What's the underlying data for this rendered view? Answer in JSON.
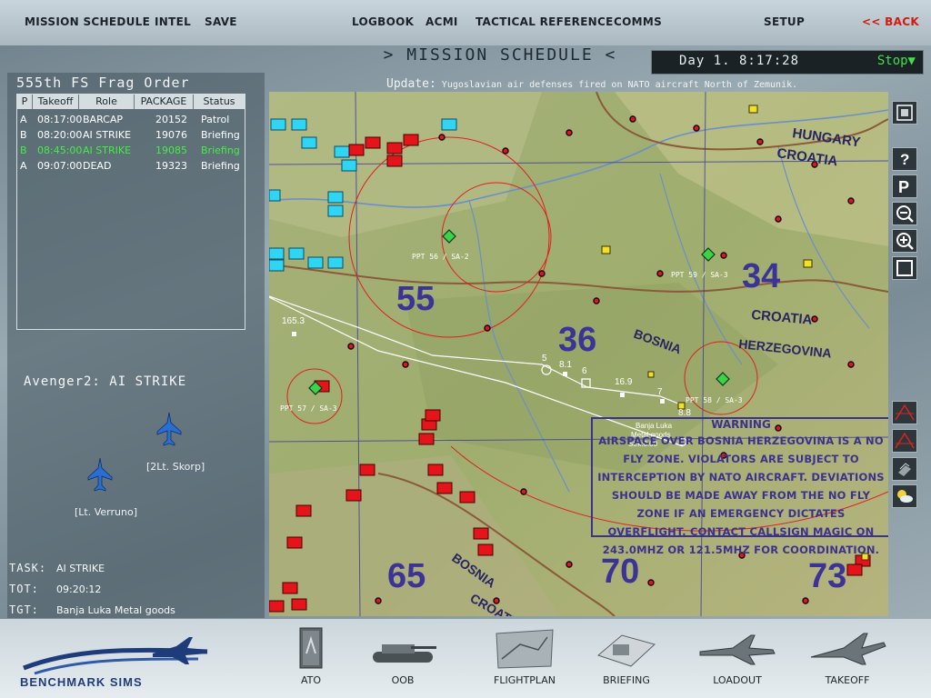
{
  "top_menu": {
    "mission_schedule": "MISSION SCHEDULE",
    "intel": "INTEL",
    "save": "SAVE",
    "logbook": "LOGBOOK",
    "acmi": "ACMI",
    "tactical_reference": "TACTICAL REFERENCE",
    "comms": "COMMS",
    "setup": "SETUP",
    "back": "<< BACK"
  },
  "screen_title": ">  MISSION SCHEDULE  <",
  "clock": {
    "day": "Day  1. 8:17:28",
    "stop": "Stop▼"
  },
  "update": {
    "label": "Update:",
    "message": "Yugoslavian air defenses fired on NATO aircraft North of Zemunik."
  },
  "frag_order": {
    "title": "555th FS Frag Order",
    "columns": [
      "P",
      "Takeoff",
      "Role",
      "PACKAGE",
      "Status"
    ],
    "rows": [
      {
        "p": "A",
        "takeoff": "08:17:00",
        "role": "BARCAP",
        "package": "20152",
        "status": "Patrol",
        "selected": false
      },
      {
        "p": "B",
        "takeoff": "08:20:00",
        "role": "AI STRIKE",
        "package": "19076",
        "status": "Briefing",
        "selected": false
      },
      {
        "p": "B",
        "takeoff": "08:45:00",
        "role": "AI STRIKE",
        "package": "19085",
        "status": "Briefing",
        "selected": true
      },
      {
        "p": "A",
        "takeoff": "09:07:00",
        "role": "DEAD",
        "package": "19323",
        "status": "Briefing",
        "selected": false
      }
    ]
  },
  "flight": {
    "name": "Avenger2: AI STRIKE",
    "pilots": [
      "[2Lt. Skorp]",
      "[Lt. Verruno]"
    ]
  },
  "task": {
    "task_label": "TASK:",
    "task_value": "AI STRIKE",
    "tot_label": "TOT:",
    "tot_value": "09:20:12",
    "tgt_label": "TGT:",
    "tgt_value": "Banja Luka Metal goods"
  },
  "map": {
    "countries": [
      "HUNGARY",
      "CROATIA",
      "CROATIA",
      "BOSNIA",
      "HERZEGOVINA",
      "BOSNIA",
      "CROATIA"
    ],
    "sector_numbers": [
      "55",
      "36",
      "34",
      "65",
      "70",
      "73"
    ],
    "threat_labels": [
      "PPT 56 / SA-2",
      "PPT 59 / SA-3",
      "PPT 58 / SA-3",
      "PPT 57 / SA-3"
    ],
    "waypoints": [
      "165.3",
      "5",
      "8.1",
      "6",
      "16.9",
      "7",
      "8.8"
    ],
    "target_labels": [
      "Banja Luka",
      "Metal goods",
      "Strk:0.00"
    ],
    "warning": {
      "title": "WARNING",
      "text": "AIRSPACE OVER BOSNIA HERZEGOVINA IS A NO FLY ZONE. VIOLATORS ARE SUBJECT TO INTERCEPTION BY NATO AIRCRAFT. DEVIATIONS SHOULD BE MADE AWAY FROM THE NO FLY ZONE IF AN EMERGENCY DICTATES OVERFLIGHT. CONTACT CALLSIGN MAGIC ON 243.0MHZ OR 121.5MHZ FOR COORDINATION."
    },
    "tools": [
      "zoom-fit-icon",
      "help-icon",
      "parking-icon",
      "zoom-out-icon",
      "zoom-in-icon",
      "fullscreen-icon",
      "threat-range-icon",
      "threat-range2-icon",
      "layers-icon",
      "weather-icon"
    ]
  },
  "bottom_nav": [
    {
      "label": "ATO",
      "icon": "binder-icon"
    },
    {
      "label": "OOB",
      "icon": "tank-icon"
    },
    {
      "label": "FLIGHTPLAN",
      "icon": "map-icon"
    },
    {
      "label": "BRIEFING",
      "icon": "briefing-icon"
    },
    {
      "label": "LOADOUT",
      "icon": "loadout-jet-icon"
    },
    {
      "label": "TAKEOFF",
      "icon": "takeoff-jet-icon"
    }
  ],
  "logo_text": "BENCHMARK SIMS",
  "colors": {
    "accent_red": "#d11a12",
    "selected_green": "#40f040",
    "warning_blue": "#3d318f",
    "route_red": "#e02020"
  }
}
